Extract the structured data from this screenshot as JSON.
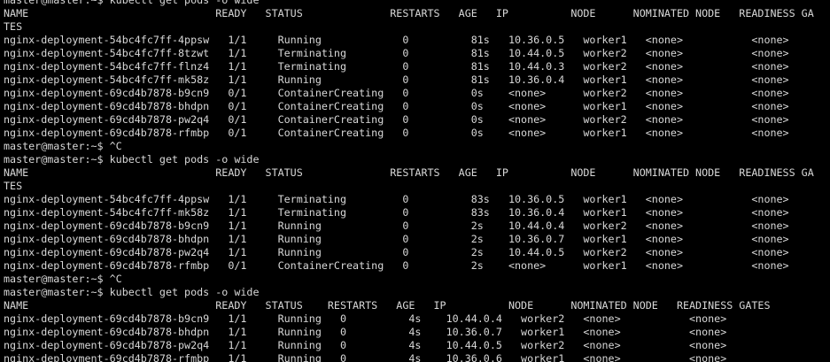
{
  "terminal": {
    "colors": {
      "background": "#000000",
      "foreground": "#d8d8d8"
    },
    "lines": [
      "master@master:~$ kubectl get pods -o wide",
      "NAME                              READY   STATUS              RESTARTS   AGE   IP          NODE      NOMINATED NODE   READINESS GA",
      "TES",
      "nginx-deployment-54bc4fc7ff-4ppsw   1/1     Running             0          81s   10.36.0.5   worker1   <none>           <none>",
      "nginx-deployment-54bc4fc7ff-8tzwt   1/1     Terminating         0          81s   10.44.0.5   worker2   <none>           <none>",
      "nginx-deployment-54bc4fc7ff-flnz4   1/1     Terminating         0          81s   10.44.0.3   worker2   <none>           <none>",
      "nginx-deployment-54bc4fc7ff-mk58z   1/1     Running             0          81s   10.36.0.4   worker1   <none>           <none>",
      "nginx-deployment-69cd4b7878-b9cn9   0/1     ContainerCreating   0          0s    <none>      worker2   <none>           <none>",
      "nginx-deployment-69cd4b7878-bhdpn   0/1     ContainerCreating   0          0s    <none>      worker1   <none>           <none>",
      "nginx-deployment-69cd4b7878-pw2q4   0/1     ContainerCreating   0          0s    <none>      worker2   <none>           <none>",
      "nginx-deployment-69cd4b7878-rfmbp   0/1     ContainerCreating   0          0s    <none>      worker1   <none>           <none>",
      "master@master:~$ ^C",
      "master@master:~$ kubectl get pods -o wide",
      "NAME                              READY   STATUS              RESTARTS   AGE   IP          NODE      NOMINATED NODE   READINESS GA",
      "TES",
      "nginx-deployment-54bc4fc7ff-4ppsw   1/1     Terminating         0          83s   10.36.0.5   worker1   <none>           <none>",
      "nginx-deployment-54bc4fc7ff-mk58z   1/1     Terminating         0          83s   10.36.0.4   worker1   <none>           <none>",
      "nginx-deployment-69cd4b7878-b9cn9   1/1     Running             0          2s    10.44.0.4   worker2   <none>           <none>",
      "nginx-deployment-69cd4b7878-bhdpn   1/1     Running             0          2s    10.36.0.7   worker1   <none>           <none>",
      "nginx-deployment-69cd4b7878-pw2q4   1/1     Running             0          2s    10.44.0.5   worker2   <none>           <none>",
      "nginx-deployment-69cd4b7878-rfmbp   0/1     ContainerCreating   0          2s    <none>      worker1   <none>           <none>",
      "master@master:~$ ^C",
      "master@master:~$ kubectl get pods -o wide",
      "NAME                              READY   STATUS    RESTARTS   AGE   IP          NODE      NOMINATED NODE   READINESS GATES",
      "nginx-deployment-69cd4b7878-b9cn9   1/1     Running   0          4s    10.44.0.4   worker2   <none>           <none>",
      "nginx-deployment-69cd4b7878-bhdpn   1/1     Running   0          4s    10.36.0.7   worker1   <none>           <none>",
      "nginx-deployment-69cd4b7878-pw2q4   1/1     Running   0          4s    10.44.0.5   worker2   <none>           <none>",
      "nginx-deployment-69cd4b7878-rfmbp   1/1     Running   0          4s    10.36.0.6   worker1   <none>           <none>"
    ]
  }
}
